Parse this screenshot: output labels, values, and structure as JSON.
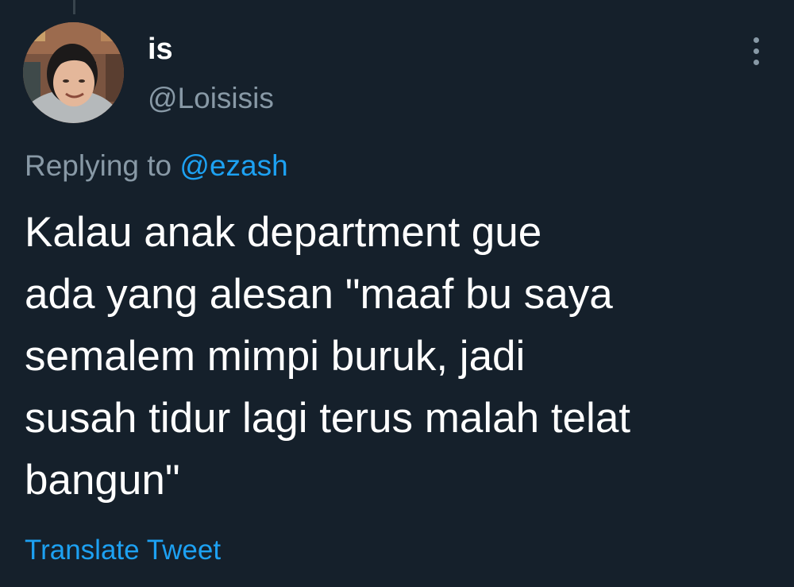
{
  "tweet": {
    "display_name": "is",
    "handle": "@Loisisis",
    "avatar_icon": "user-avatar-photo",
    "more_icon": "more-vertical-icon",
    "replying_prefix": "Replying to",
    "replying_mention": "@ezash",
    "text_lines": [
      "Kalau anak department gue",
      "ada yang alesan \"maaf bu saya",
      "semalem mimpi buruk, jadi",
      "susah tidur lagi terus malah telat",
      "bangun\""
    ],
    "translate_label": "Translate Tweet"
  },
  "colors": {
    "background": "#15202b",
    "text_primary": "#ffffff",
    "text_secondary": "#8899a6",
    "accent": "#1da1f2"
  }
}
